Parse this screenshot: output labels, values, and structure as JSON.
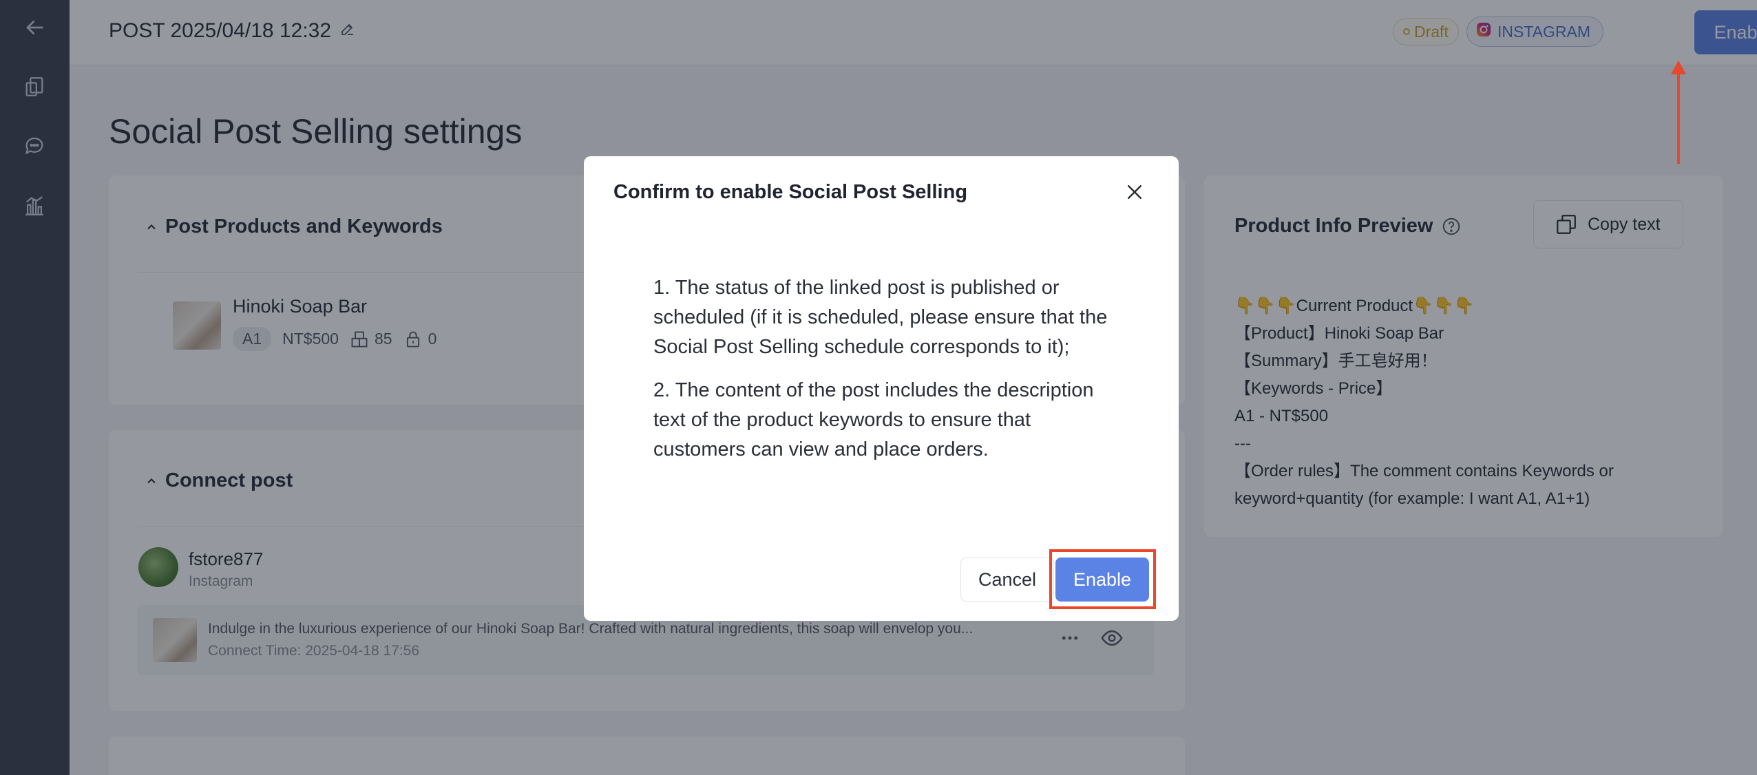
{
  "topbar": {
    "post_title": "POST 2025/04/18 12:32",
    "status_badge": "Draft",
    "platform_badge": "INSTAGRAM",
    "enable_label": "Enable"
  },
  "page": {
    "heading": "Social Post Selling settings"
  },
  "products_card": {
    "title": "Post Products and Keywords",
    "product": {
      "name": "Hinoki Soap Bar",
      "keyword": "A1",
      "price": "NT$500",
      "stock": "85",
      "locked": "0"
    }
  },
  "connect_card": {
    "title": "Connect post",
    "account_name": "fstore877",
    "account_platform": "Instagram",
    "post_text": "Indulge in the luxurious experience of our Hinoki Soap Bar! Crafted with natural ingredients, this soap will envelop you...",
    "connect_time": "Connect Time: 2025-04-18 17:56"
  },
  "preview_card": {
    "title": "Product Info Preview",
    "copy_label": "Copy text",
    "lines": [
      "👇👇👇Current Product👇👇👇",
      "【Product】Hinoki Soap Bar",
      "【Summary】手工皂好用！",
      "【Keywords - Price】",
      "A1 - NT$500",
      "---",
      "【Order rules】The comment contains Keywords or",
      "keyword+quantity (for example: I want A1, A1+1)"
    ]
  },
  "modal": {
    "title": "Confirm to enable Social Post Selling",
    "point1": "1. The status of the linked post is published or scheduled (if it is scheduled, please ensure that the Social Post Selling schedule corresponds to it);",
    "point2": "2. The content of the post includes the description text of the product keywords to ensure that customers can view and place orders.",
    "cancel_label": "Cancel",
    "enable_label": "Enable"
  },
  "colors": {
    "primary": "#5b83e6",
    "sidebar": "#3c4250",
    "annotation": "#e8472c",
    "draft": "#c9a230"
  }
}
